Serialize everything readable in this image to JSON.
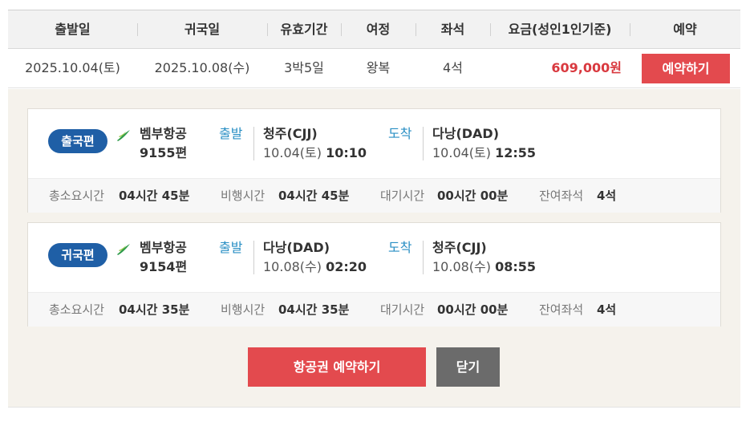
{
  "table": {
    "headers": {
      "departure_date": "출발일",
      "return_date": "귀국일",
      "validity": "유효기간",
      "itinerary": "여정",
      "seats": "좌석",
      "fare": "요금(성인1인기준)",
      "reserve": "예약"
    },
    "row": {
      "departure_date": "2025.10.04(토)",
      "return_date": "2025.10.08(수)",
      "validity": "3박5일",
      "itinerary": "왕복",
      "seats": "4석",
      "fare": "609,000원",
      "reserve_label": "예약하기"
    }
  },
  "outbound": {
    "badge": "출국편",
    "airline": "벰부항공",
    "flight_no": "9155편",
    "depart_label": "출발",
    "depart_airport": "청주(CJJ)",
    "depart_date": "10.04(토)",
    "depart_time": "10:10",
    "arrive_label": "도착",
    "arrive_airport": "다낭(DAD)",
    "arrive_date": "10.04(토)",
    "arrive_time": "12:55",
    "total_time_label": "총소요시간",
    "total_time": "04시간 45분",
    "flight_time_label": "비행시간",
    "flight_time": "04시간 45분",
    "wait_time_label": "대기시간",
    "wait_time": "00시간 00분",
    "remaining_seats_label": "잔여좌석",
    "remaining_seats": "4석"
  },
  "inbound": {
    "badge": "귀국편",
    "airline": "벰부항공",
    "flight_no": "9154편",
    "depart_label": "출발",
    "depart_airport": "다낭(DAD)",
    "depart_date": "10.08(수)",
    "depart_time": "02:20",
    "arrive_label": "도착",
    "arrive_airport": "청주(CJJ)",
    "arrive_date": "10.08(수)",
    "arrive_time": "08:55",
    "total_time_label": "총소요시간",
    "total_time": "04시간 35분",
    "flight_time_label": "비행시간",
    "flight_time": "04시간 35분",
    "wait_time_label": "대기시간",
    "wait_time": "00시간 00분",
    "remaining_seats_label": "잔여좌석",
    "remaining_seats": "4석"
  },
  "actions": {
    "book_ticket_label": "항공권 예약하기",
    "close_label": "닫기"
  },
  "colors": {
    "accent_red": "#e34a4e",
    "badge_blue": "#1f5fa6",
    "direction_blue": "#2a8fc4",
    "panel_bg": "#f5f2ec",
    "airline_green": "#2e9a4a"
  }
}
